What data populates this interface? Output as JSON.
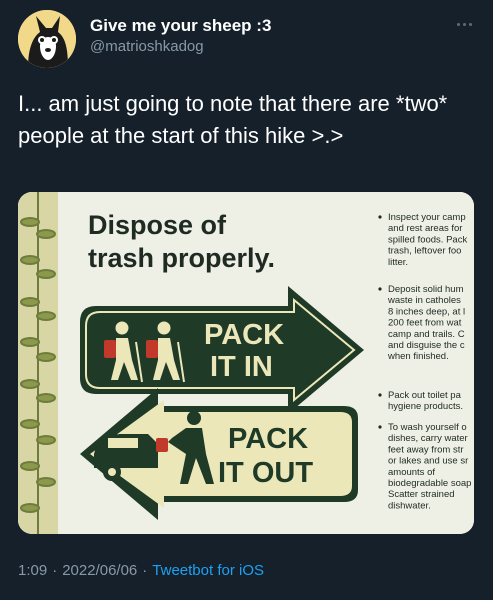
{
  "author": {
    "display_name": "Give me your sheep :3",
    "handle": "@matrioshkadog"
  },
  "tweet": {
    "text": "I... am just going to note that there are *two* people at the start of this hike >.>"
  },
  "sign": {
    "heading_line1": "Dispose of",
    "heading_line2": "trash properly.",
    "pack_in_line1": "PACK",
    "pack_in_line2": "IT IN",
    "pack_out_line1": "PACK",
    "pack_out_line2": "IT OUT",
    "bullet1": [
      "Inspect your camp",
      "and rest areas for",
      "spilled foods. Pack",
      "trash, leftover foo",
      "litter."
    ],
    "bullet2": [
      "Deposit solid hum",
      "waste in catholes",
      "8 inches deep, at l",
      "200 feet from wat",
      "camp and trails. C",
      "and disguise the c",
      "when finished."
    ],
    "bullet3": [
      "Pack out toilet pa",
      "hygiene products."
    ],
    "bullet4": [
      "To wash yourself o",
      "dishes, carry water",
      "feet away from str",
      "or lakes and use sr",
      "amounts of",
      "biodegradable soap",
      "Scatter strained",
      "dishwater."
    ],
    "colors": {
      "sign_green": "#1f3a27",
      "sign_cream": "#ece7b9",
      "panel_bg": "#eef0e6"
    }
  },
  "footer": {
    "time": "1:09",
    "date": "2022/06/06",
    "client": "Tweetbot for iOS"
  },
  "icons": [
    "avatar-dog",
    "more-dots-icon",
    "hikers-icon",
    "car-trash-icon"
  ]
}
